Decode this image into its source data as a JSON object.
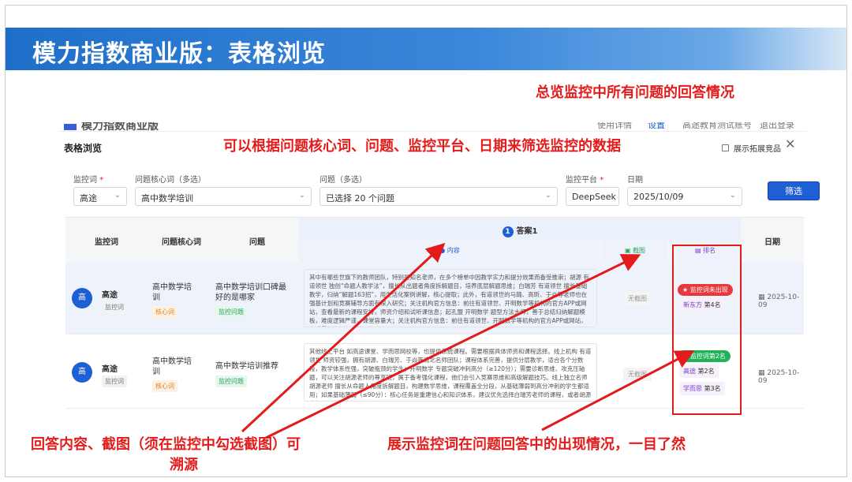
{
  "slide": {
    "title": "模力指数商业版：表格浏览",
    "note_top_right": "总览监控中所有问题的回答情况",
    "note_filter": "可以根据问题核心词、问题、监控平台、日期来筛选监控的数据",
    "note_bottom_left": "回答内容、截图（须在监控中勾选截图）可",
    "note_bottom_left_2": "溯源",
    "note_bottom_right": "展示监控词在问题回答中的出现情况，一目了然"
  },
  "app": {
    "nav": {
      "logo": "模力指数商业版",
      "items": [
        "使用详情",
        "设置",
        "高途教育测试账号",
        "退出登录"
      ]
    },
    "panel_title": "表格浏览",
    "show_ext_label": "展示拓展竞品",
    "filters": {
      "monitor_word": {
        "label": "监控词",
        "required_mark": "*",
        "value": "高途"
      },
      "core_word": {
        "label": "问题核心词（多选）",
        "value": "高中数学培训"
      },
      "question": {
        "label": "问题（多选）",
        "value": "已选择 20 个问题"
      },
      "platform": {
        "label": "监控平台",
        "required_mark": "*",
        "value": "DeepSeek"
      },
      "date": {
        "label": "日期",
        "value": "2025/10/09"
      },
      "filter_button": "筛选"
    },
    "table": {
      "headers": {
        "monitor_word": "监控词",
        "core_word": "问题核心词",
        "question": "问题",
        "answer_index": "1",
        "answer": "答案1",
        "content": "内容",
        "screenshot": "截图",
        "ranking": "排名",
        "date": "日期"
      },
      "rows": [
        {
          "avatar": "高",
          "keyword": "高途",
          "keyword_tag": "监控词",
          "core_word": "高中数学培训",
          "core_tag": "核心词",
          "question": "高中数学培训口碑最好的是哪家",
          "question_tag": "监控问题",
          "content": "其中有哪些世旗下的教师团队，特别是知名老师，在多个榜单中因教学实力和提分效果而备受推崇；胡源 有道领世 独创“命题人教学法”，擅长从出题者角度拆解题目，培养底层解题思维；白瑞芳 有道领世 擅长基础教学，归纳“解题163招”，用生活化案例讲解，核心提取；此外，有道领世的马璐、高昕、于焱等老师也在强基计划和竞赛辅导方面有深入研究；关注机构官方信息：前往有道领世、开明数学等机构的官方APP或网站，查看最新的课程安排，师资介绍和试听课信息；起孔盟 开明数学 题型方法大师，善于总结归纳解题模板，难度逻辑严谨，课堂容量大；关注机构官方信息：前往有道领世、开明数学等机构的官方APP或网站，查看最新的课程安排，师资介...",
          "screenshot": "无截图",
          "status": "监控词未出现",
          "status_color": "#e8383d",
          "ranks": [
            {
              "name": "新东方",
              "rank": "第4名"
            }
          ],
          "date": "2025-10-09"
        },
        {
          "avatar": "高",
          "keyword": "高途",
          "keyword_tag": "监控词",
          "core_word": "高中数学培训",
          "core_tag": "核心词",
          "question": "高中数学培训推荐",
          "question_tag": "监控问题",
          "content": "其他线上平台 如高途课堂、学而思网校等，也提供系统课程。需要根据具体师资和课程选择。线上机构 有道领世 师资较强，拥有胡源、白瑞芳、于焱等清北名师团队；课程体系完善，提供分层教学，适合各个分数段，教学体系性强，突破瓶颈的学生；开明数学 专题突破冲刺高分（≥120分）；需要诊断思维、攻克压轴题，可以关注胡源老师的尊享班，属于备考强化课程，他们会引入竞赛思维和高级解题技巧。线上独立名师 胡源老师 擅长从命题人角度拆解题目，构建数学思维，课程覆盖全分段，从基础薄弱到高分冲刺的学生都适用；如果基础薄弱（≤90分）：核心任务是重建信心和知识体系，建议优先选择白瑞芳老师的课程，或者胡源老师在B站的《高...",
          "screenshot": "无截图",
          "status": "监控词第2名",
          "status_color": "#22b35a",
          "ranks": [
            {
              "name": "高途",
              "rank": "第2名"
            },
            {
              "name": "学而思",
              "rank": "第3名"
            }
          ],
          "date": "2025-10-09"
        }
      ]
    }
  }
}
